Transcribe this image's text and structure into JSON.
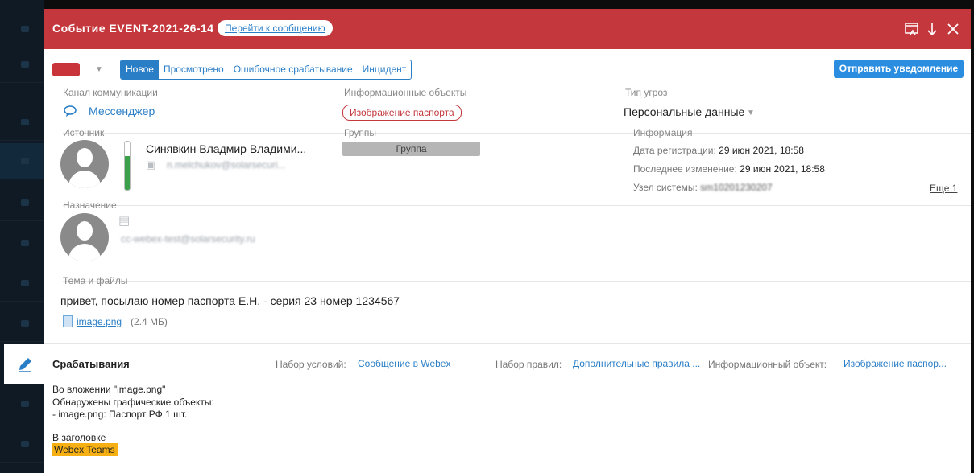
{
  "header": {
    "title": "Событие EVENT-2021-26-14",
    "goto_label": "Перейти к сообщению"
  },
  "toolbar": {
    "tabs": [
      "Новое",
      "Просмотрено",
      "Ошибочное срабатывание",
      "Инцидент"
    ],
    "active_tab": "Новое",
    "send_label": "Отправить уведомление"
  },
  "channel": {
    "label": "Канал коммуникации",
    "value": "Мессенджер",
    "icon": "chat-icon"
  },
  "info_objects": {
    "label": "Информационные объекты",
    "tag": "Изображение паспорта"
  },
  "threat": {
    "label": "Тип угроз",
    "value": "Персональные данные"
  },
  "source": {
    "label": "Источник",
    "name": "Синявкин Владмир Владими...",
    "email": "n.melchukov@solarsecuri...",
    "level": 0.7
  },
  "groups": {
    "label": "Группы",
    "value": "Группа"
  },
  "info": {
    "label": "Информация",
    "reg_label": "Дата регистрации:",
    "reg_value": "29 июн 2021, 18:58",
    "mod_label": "Последнее изменение:",
    "mod_value": "29 июн 2021, 18:58",
    "node_label": "Узел системы:",
    "node_value": "sm10201230207",
    "more": "Еще 1"
  },
  "destination": {
    "label": "Назначение",
    "email": "cc-webex-test@solarsecurity.ru"
  },
  "subject": {
    "label": "Тема и файлы",
    "text": "привет, посылаю номер паспорта Е.Н. - серия 23 номер 1234567",
    "file_name": "image.png",
    "file_size": "(2.4 МБ)"
  },
  "triggers": {
    "title": "Срабатывания",
    "cond_label": "Набор условий:",
    "cond_value": "Сообщение в Webex",
    "rules_label": "Набор правил:",
    "rules_value": "Дополнительные правила ...",
    "obj_label": "Информационный объект:",
    "obj_value": "Изображение паспор...",
    "lines": [
      "Во вложении \"image.png\"",
      "Обнаружены графические объекты:",
      "- image.png: Паспорт РФ 1 шт.",
      "В заголовке"
    ],
    "highlight": "Webex Teams"
  },
  "colors": {
    "header": "#c4373d",
    "accent": "#2a7ec6",
    "highlight": "#f7b014"
  }
}
